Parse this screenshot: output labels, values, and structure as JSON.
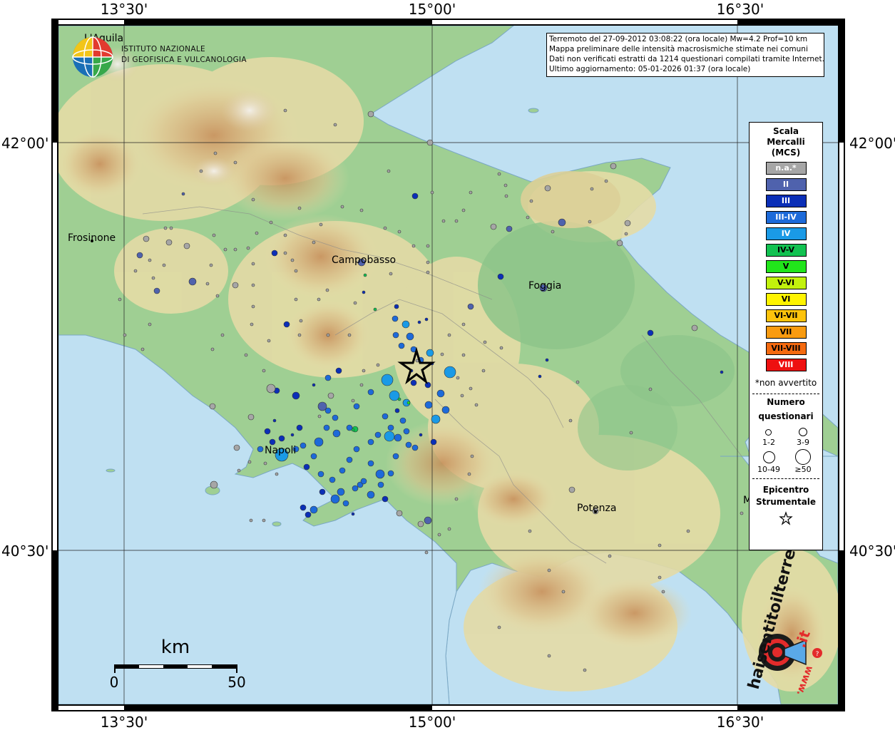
{
  "map": {
    "lon_ticks": [
      "13°30'",
      "15°00'",
      "16°30'"
    ],
    "lat_ticks": [
      "42°00'",
      "40°30'"
    ],
    "cities": [
      {
        "name": "Frosinone"
      },
      {
        "name": "Campobasso"
      },
      {
        "name": "Foggia"
      },
      {
        "name": "Napoli"
      },
      {
        "name": "Potenza"
      }
    ],
    "partial_labels": [
      "L'Aquila",
      "M"
    ],
    "scalebar": {
      "unit": "km",
      "start": "0",
      "end": "50"
    },
    "epicenter_symbol": "star-icon"
  },
  "ingv": {
    "line1": "ISTITUTO NAZIONALE",
    "line2": "DI GEOFISICA E VULCANOLOGIA",
    "logo_icon": "globe-logo-icon"
  },
  "header": {
    "line1": "Terremoto del 27-09-2012 03:08:22 (ora locale) Mw=4.2 Prof=10 km",
    "line2": "Mappa preliminare delle intensità macrosismiche stimate nei comuni",
    "line3": "Dati non verificati estratti da 1214 questionari compilati tramite Internet.",
    "line4": "Ultimo aggiornamento: 05-01-2026 01:37 (ora locale)"
  },
  "legend": {
    "title": [
      "Scala",
      "Mercalli",
      "(MCS)"
    ],
    "scale": [
      {
        "label": "n.a.*",
        "color": "#a6a6a6",
        "text": "#ffffff"
      },
      {
        "label": "II",
        "color": "#4f62ad",
        "text": "#ffffff"
      },
      {
        "label": "III",
        "color": "#0b2fb7",
        "text": "#ffffff"
      },
      {
        "label": "III-IV",
        "color": "#1d6ad9",
        "text": "#ffffff"
      },
      {
        "label": "IV",
        "color": "#1a9ae6",
        "text": "#ffffff"
      },
      {
        "label": "IV-V",
        "color": "#12c251",
        "text": "#000000"
      },
      {
        "label": "V",
        "color": "#21e51b",
        "text": "#000000"
      },
      {
        "label": "V-VI",
        "color": "#c2f20d",
        "text": "#000000"
      },
      {
        "label": "VI",
        "color": "#fff400",
        "text": "#000000"
      },
      {
        "label": "VI-VII",
        "color": "#fdc30c",
        "text": "#000000"
      },
      {
        "label": "VII",
        "color": "#f99b10",
        "text": "#000000"
      },
      {
        "label": "VII-VIII",
        "color": "#f46a10",
        "text": "#000000"
      },
      {
        "label": "VIII",
        "color": "#ee1010",
        "text": "#ffffff"
      }
    ],
    "note": "*non avvertito",
    "count_title_1": "Numero",
    "count_title_2": "questionari",
    "counts": [
      "1-2",
      "3-9",
      "10-49",
      "≥50"
    ],
    "epi_1": "Epicentro",
    "epi_2": "Strumentale"
  },
  "brand": {
    "text_main": "haisentitoilterremoto",
    "text_domain": ".it",
    "text_prefix": "www.",
    "icon": "target-megaphone-logo-icon"
  },
  "colors": {
    "sea": "#bfe0f2",
    "lowland": "#8fc88c",
    "hill": "#e8dcaa",
    "mountain": "#c9925e",
    "frame": "#000000"
  }
}
